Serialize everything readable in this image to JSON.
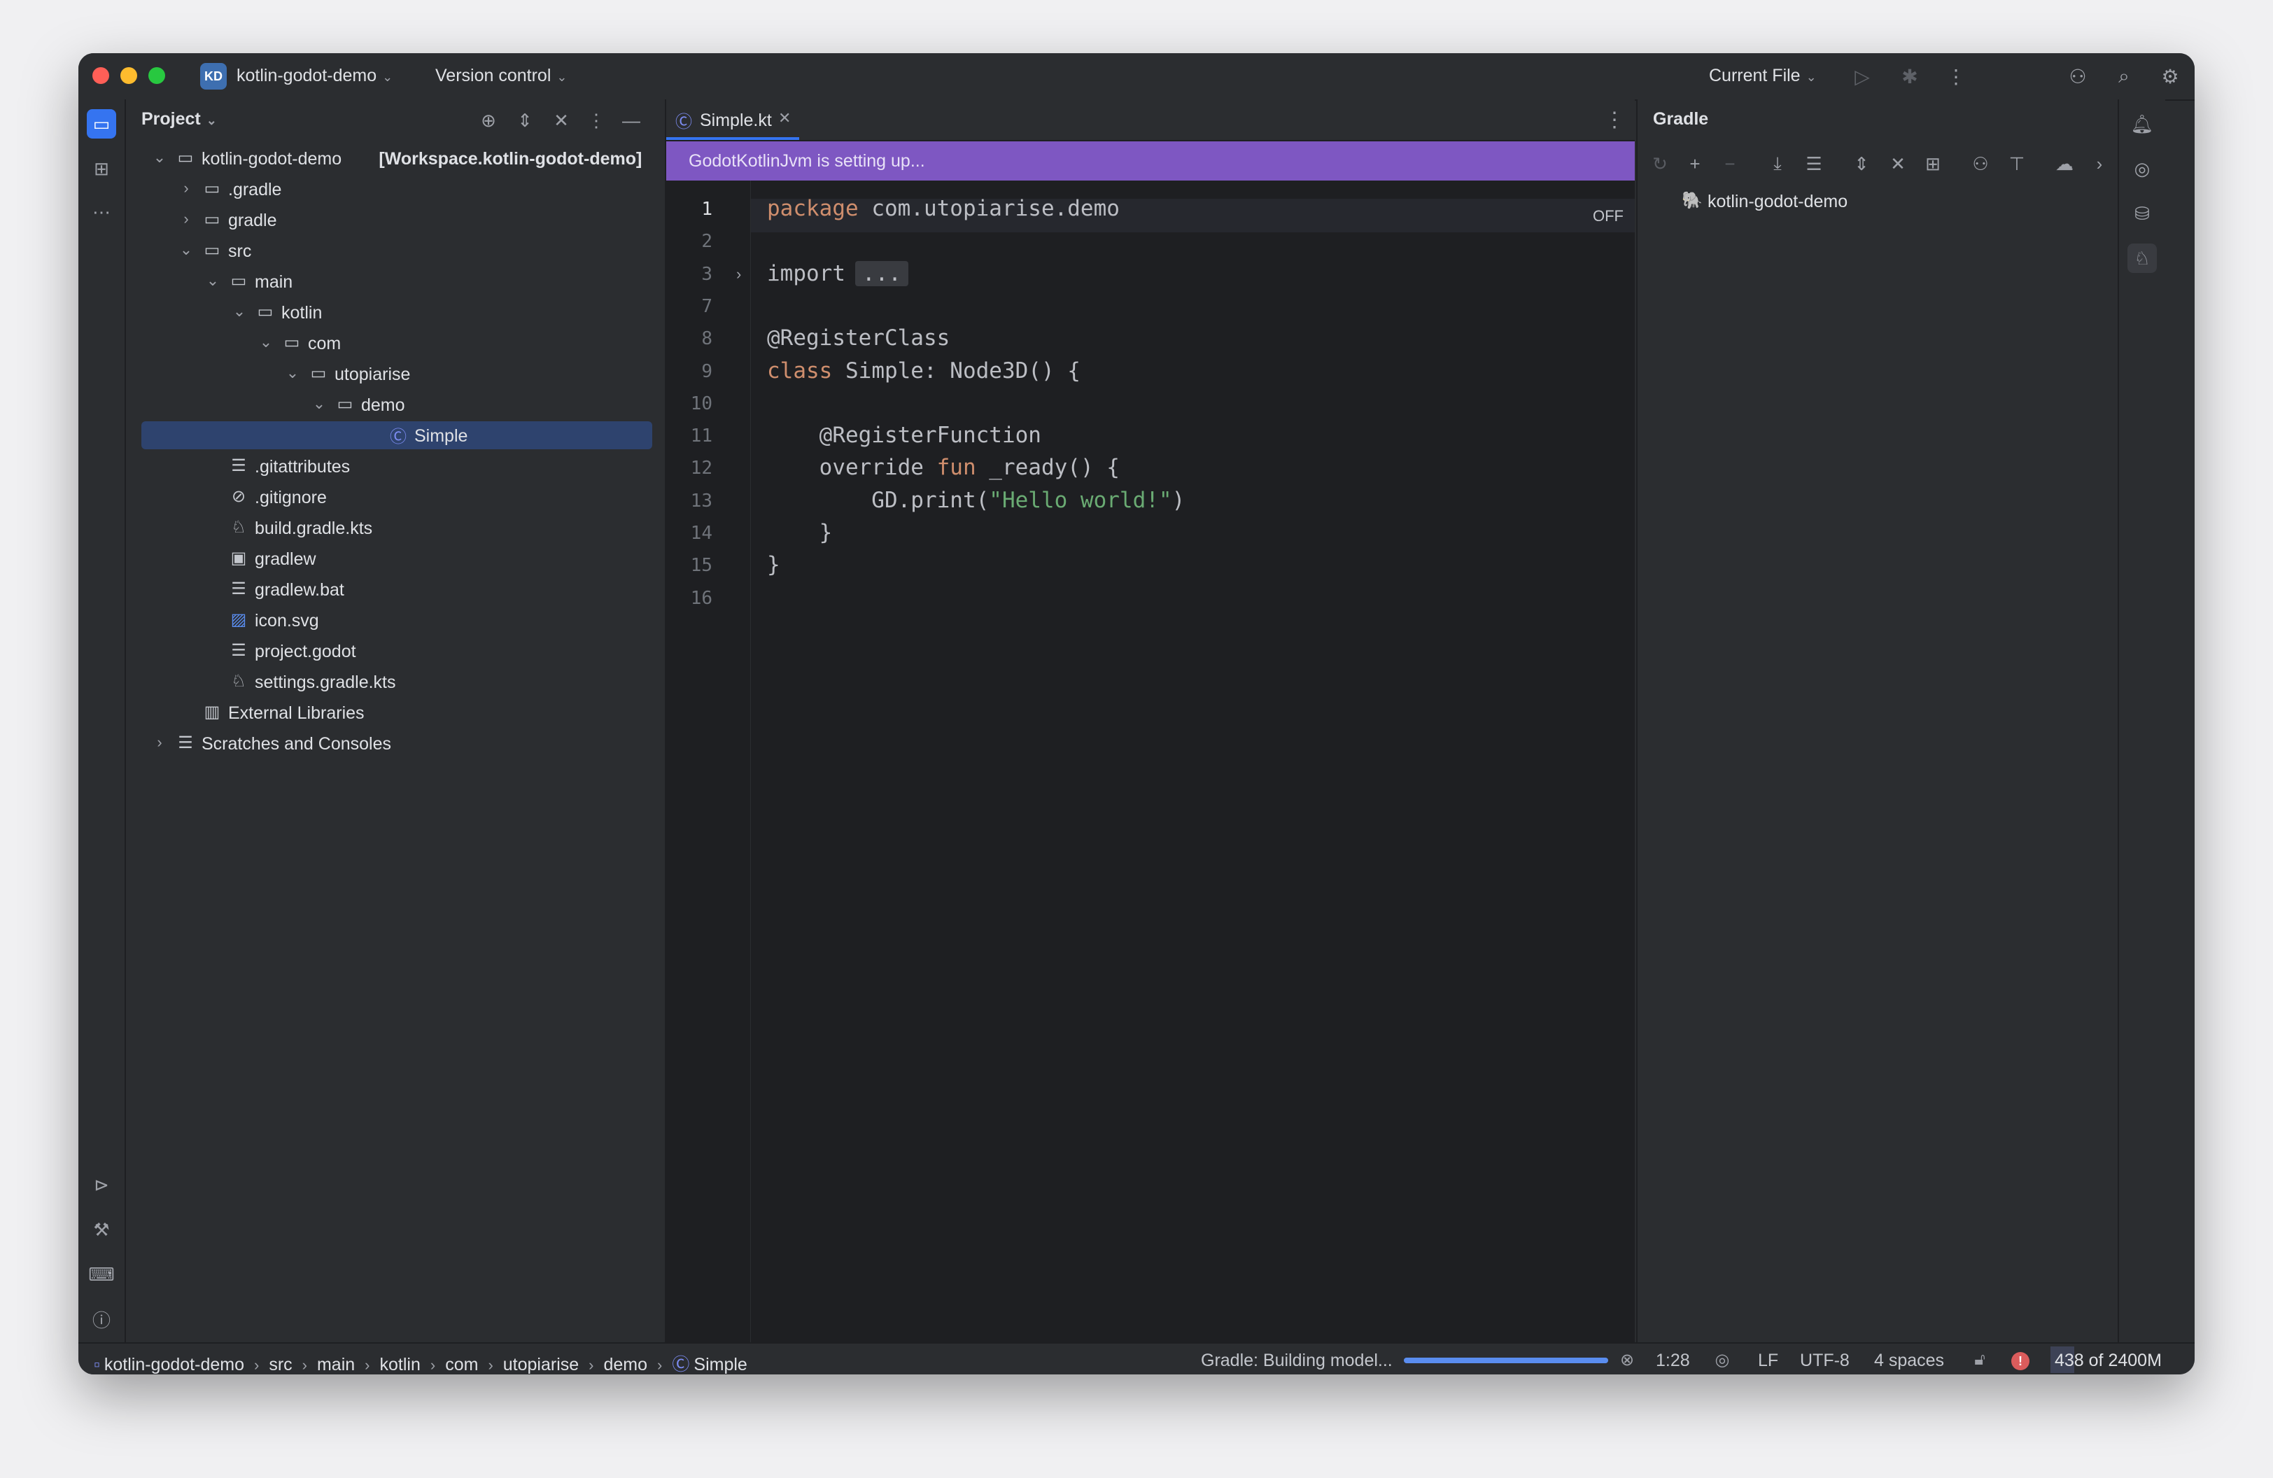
{
  "titlebar": {
    "project_initials": "KD",
    "project_name": "kotlin-godot-demo",
    "version_control": "Version control",
    "run_config": "Current File",
    "icons": [
      "run-icon",
      "debug-icon",
      "more-icon",
      "add-user-icon",
      "search-icon",
      "settings-icon"
    ]
  },
  "left_strip": {
    "top_icons": [
      "project-folder-icon",
      "structure-icon",
      "more-tools-icon"
    ],
    "bottom_icons": [
      "services-icon",
      "build-icon",
      "terminal-icon",
      "problems-icon",
      "git-icon"
    ]
  },
  "project_panel": {
    "title": "Project",
    "tree": [
      {
        "label": "kotlin-godot-demo",
        "suffix": "[Workspace.kotlin-godot-demo]",
        "icon": "module-folder-icon",
        "arrow": "⌄",
        "depth": 0
      },
      {
        "label": ".gradle",
        "icon": "folder-icon",
        "arrow": "›",
        "depth": 1
      },
      {
        "label": "gradle",
        "icon": "folder-icon",
        "arrow": "›",
        "depth": 1
      },
      {
        "label": "src",
        "icon": "folder-icon",
        "arrow": "⌄",
        "depth": 1
      },
      {
        "label": "main",
        "icon": "folder-icon",
        "arrow": "⌄",
        "depth": 2
      },
      {
        "label": "kotlin",
        "icon": "folder-icon",
        "arrow": "⌄",
        "depth": 3
      },
      {
        "label": "com",
        "icon": "folder-icon",
        "arrow": "⌄",
        "depth": 4
      },
      {
        "label": "utopiarise",
        "icon": "folder-icon",
        "arrow": "⌄",
        "depth": 5
      },
      {
        "label": "demo",
        "icon": "folder-icon",
        "arrow": "⌄",
        "depth": 6
      },
      {
        "label": "Simple",
        "icon": "kotlin-class-icon",
        "arrow": "",
        "depth": 8,
        "selected": true
      },
      {
        "label": ".gitattributes",
        "icon": "text-file-icon",
        "arrow": "",
        "depth": 2
      },
      {
        "label": ".gitignore",
        "icon": "ignore-file-icon",
        "arrow": "",
        "depth": 2
      },
      {
        "label": "build.gradle.kts",
        "icon": "gradle-file-icon",
        "arrow": "",
        "depth": 2
      },
      {
        "label": "gradlew",
        "icon": "shell-script-icon",
        "arrow": "",
        "depth": 2
      },
      {
        "label": "gradlew.bat",
        "icon": "text-file-icon",
        "arrow": "",
        "depth": 2
      },
      {
        "label": "icon.svg",
        "icon": "image-file-icon",
        "arrow": "",
        "depth": 2
      },
      {
        "label": "project.godot",
        "icon": "text-file-icon",
        "arrow": "",
        "depth": 2
      },
      {
        "label": "settings.gradle.kts",
        "icon": "gradle-file-icon",
        "arrow": "",
        "depth": 2
      },
      {
        "label": "External Libraries",
        "icon": "library-icon",
        "arrow": "",
        "depth": 1
      },
      {
        "label": "Scratches and Consoles",
        "icon": "scratches-icon",
        "arrow": "›",
        "depth": 0
      }
    ]
  },
  "editor": {
    "tab_label": "Simple.kt",
    "banner": "GodotKotlinJvm is setting up...",
    "off_label": "OFF",
    "lines": [
      {
        "n": "1",
        "tokens": [
          {
            "t": "package",
            "c": "kw"
          },
          {
            "t": " com.utopiarise.demo",
            "c": ""
          }
        ]
      },
      {
        "n": "2",
        "tokens": []
      },
      {
        "n": "3",
        "fold": true,
        "tokens": [
          {
            "t": "import",
            "c": ""
          }
        ],
        "folded": "..."
      },
      {
        "n": "7",
        "tokens": []
      },
      {
        "n": "8",
        "tokens": [
          {
            "t": "@RegisterClass",
            "c": ""
          }
        ]
      },
      {
        "n": "9",
        "tokens": [
          {
            "t": "class",
            "c": "kw"
          },
          {
            "t": " Simple: Node3D() {",
            "c": ""
          }
        ]
      },
      {
        "n": "10",
        "tokens": []
      },
      {
        "n": "11",
        "tokens": [
          {
            "t": "    @RegisterFunction",
            "c": ""
          }
        ]
      },
      {
        "n": "12",
        "tokens": [
          {
            "t": "    override ",
            "c": ""
          },
          {
            "t": "fun",
            "c": "kw"
          },
          {
            "t": " _ready() {",
            "c": ""
          }
        ]
      },
      {
        "n": "13",
        "tokens": [
          {
            "t": "        GD.print(",
            "c": ""
          },
          {
            "t": "\"Hello world!\"",
            "c": "str"
          },
          {
            "t": ")",
            "c": ""
          }
        ]
      },
      {
        "n": "14",
        "tokens": [
          {
            "t": "    }",
            "c": ""
          }
        ]
      },
      {
        "n": "15",
        "tokens": [
          {
            "t": "}",
            "c": ""
          }
        ]
      },
      {
        "n": "16",
        "tokens": []
      }
    ]
  },
  "gradle_panel": {
    "title": "Gradle",
    "node_label": "kotlin-godot-demo",
    "toolbar_icons": [
      "reload-icon",
      "add-icon",
      "remove-icon",
      "download-icon",
      "tasks-icon",
      "expand-all-icon",
      "collapse-all-icon",
      "new-module-icon",
      "analyze-icon",
      "show-dependencies-icon",
      "offline-mode-icon",
      "more-chevron-icon"
    ]
  },
  "right_strip": {
    "icons": [
      "notifications-icon",
      "ai-assistant-icon",
      "database-icon",
      "gradle-icon"
    ]
  },
  "statusbar": {
    "breadcrumbs": [
      "kotlin-godot-demo",
      "src",
      "main",
      "kotlin",
      "com",
      "utopiarise",
      "demo",
      "Simple"
    ],
    "task": "Gradle: Building model...",
    "task_progress": 1.0,
    "position": "1:28",
    "line_sep": "LF",
    "encoding": "UTF-8",
    "indent": "4 spaces",
    "memory": "438 of 2400M",
    "memory_fraction": 0.18,
    "error_mark": "!"
  }
}
